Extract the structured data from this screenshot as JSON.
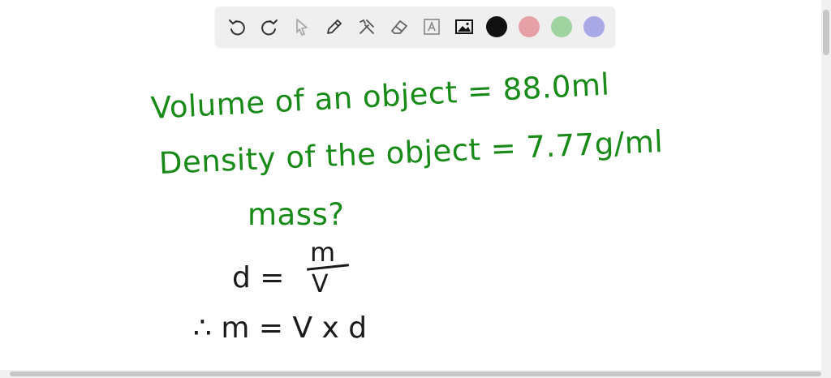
{
  "toolbar": {
    "tools": [
      {
        "name": "undo-icon",
        "label": "Undo"
      },
      {
        "name": "redo-icon",
        "label": "Redo"
      },
      {
        "name": "select-icon",
        "label": "Select"
      },
      {
        "name": "pen-icon",
        "label": "Pen"
      },
      {
        "name": "tools-icon",
        "label": "Tools"
      },
      {
        "name": "eraser-icon",
        "label": "Eraser"
      },
      {
        "name": "text-icon",
        "label": "Text"
      },
      {
        "name": "image-icon",
        "label": "Image"
      }
    ],
    "colors": [
      "#111111",
      "#e6a1a6",
      "#9fd39f",
      "#a8a8e6"
    ]
  },
  "notes": {
    "line1": "Volume of an object = 88.0ml",
    "line2": "Density of the object = 7.77g/ml",
    "line3": "mass?",
    "d_eq": "d =",
    "frac_num": "m",
    "frac_den": "V",
    "result": "∴ m =  V x d"
  },
  "colors": {
    "ink_green": "#178a17",
    "ink_black": "#1a1a1a"
  }
}
